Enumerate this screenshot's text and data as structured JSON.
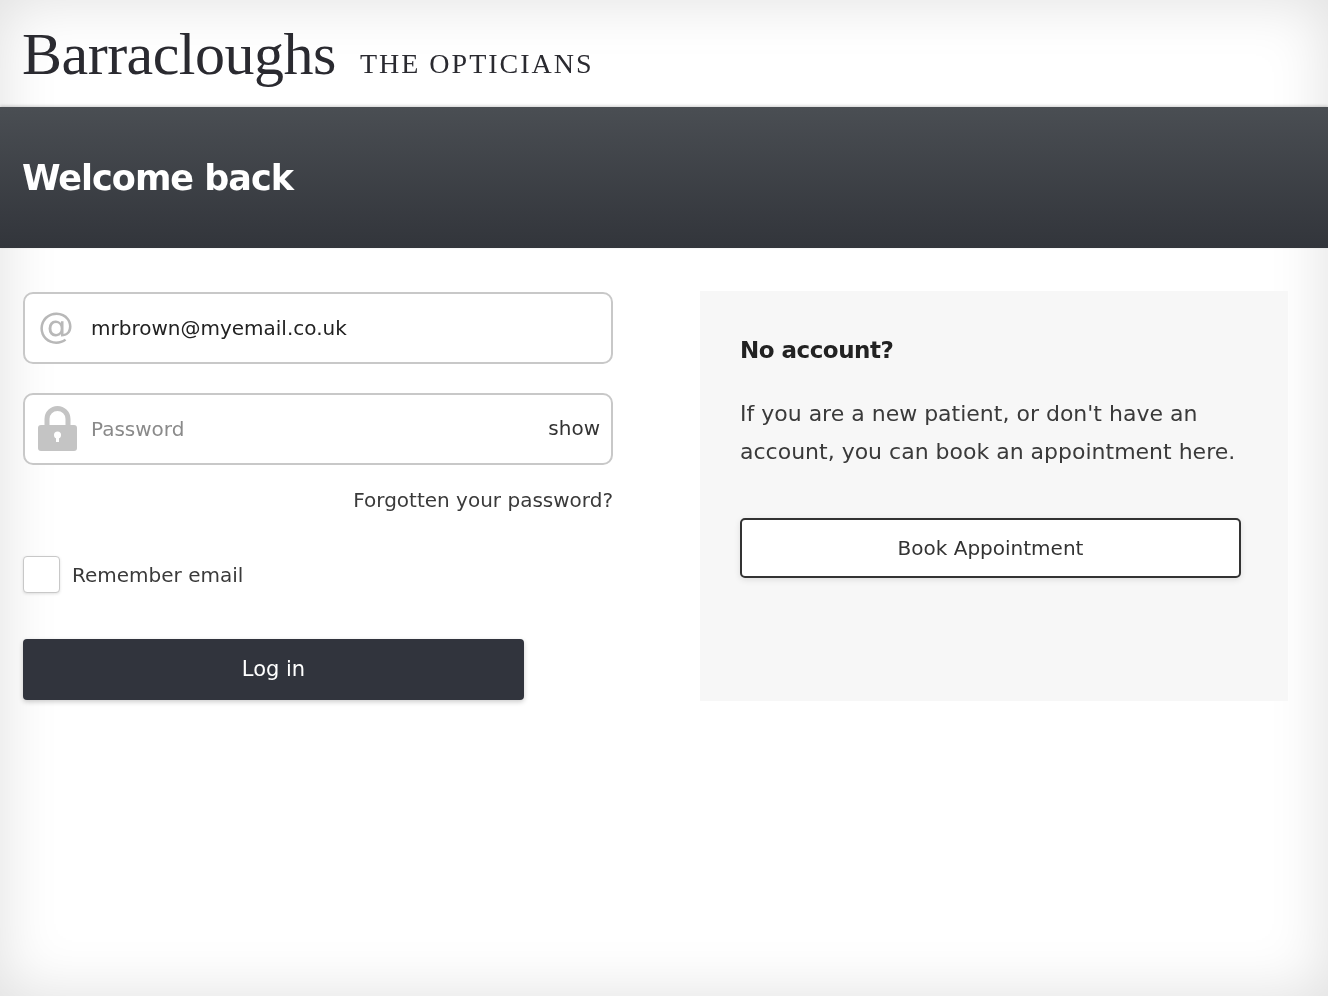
{
  "header": {
    "logo": "Barracloughs",
    "tagline": "THE OPTICIANS"
  },
  "banner": {
    "title": "Welcome back"
  },
  "login_form": {
    "email_field": {
      "icon": "@",
      "value": "mrbrown@myemail.co.uk"
    },
    "password_field": {
      "placeholder": "Password",
      "toggle": "show"
    },
    "forgot_link": "Forgotten your password?",
    "remember": {
      "label": "Remember email",
      "checked": false
    },
    "submit": "Log in"
  },
  "signup_panel": {
    "title": "No account?",
    "text": "If you are a new patient, or don't have an account, you can book an appointment here.",
    "button": "Book Appointment"
  }
}
